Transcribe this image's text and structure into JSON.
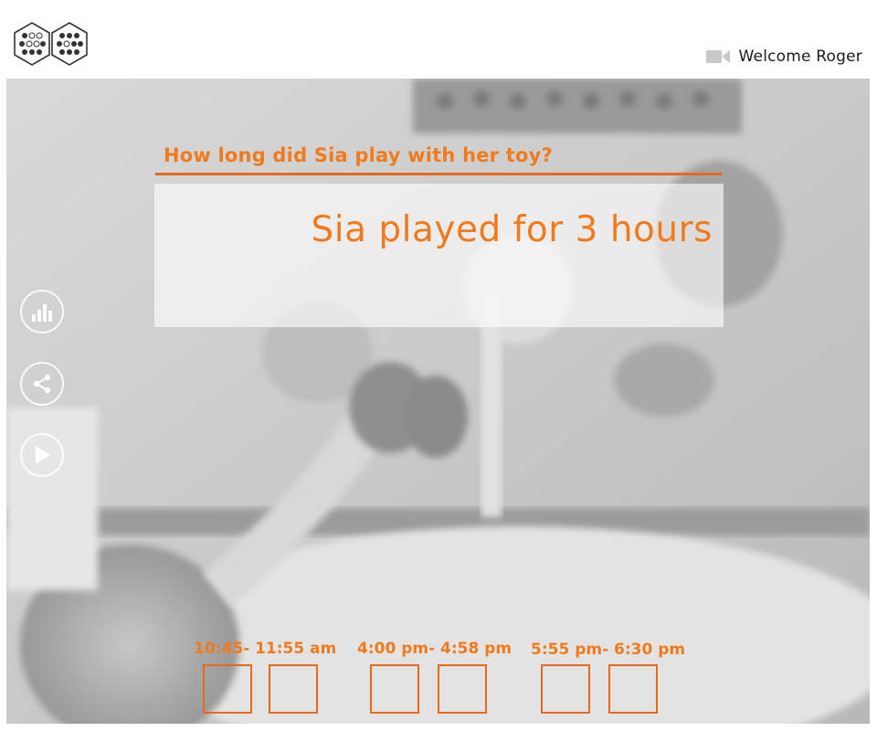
{
  "header": {
    "welcome_text": "Welcome Roger",
    "logo_icon": "honeycomb-dots-logo",
    "camera_icon": "video-camera-icon"
  },
  "question": {
    "title": "How long did Sia play with her toy?",
    "answer": "Sia played for 3 hours"
  },
  "side_actions": [
    {
      "icon": "bar-chart-icon"
    },
    {
      "icon": "share-icon"
    },
    {
      "icon": "play-icon"
    }
  ],
  "time_slots": [
    {
      "label": "10:45- 11:55 am"
    },
    {
      "label": "4:00 pm- 4:58 pm"
    },
    {
      "label": "5:55 pm- 6:30 pm"
    }
  ],
  "colors": {
    "accent": "#f07a1c",
    "rule": "#e8691b",
    "text_dark": "#1b1b1b"
  }
}
